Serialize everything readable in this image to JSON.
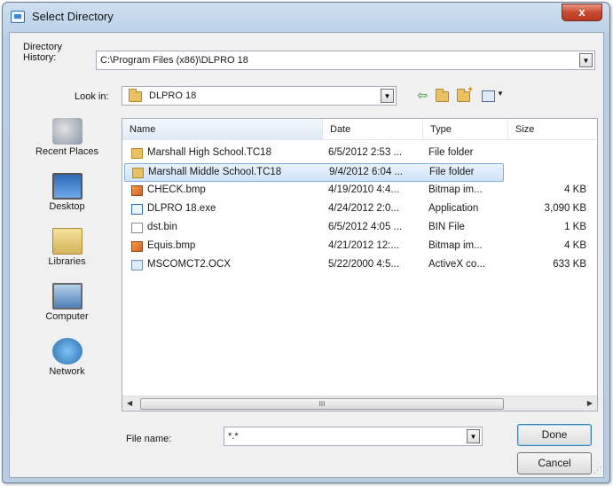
{
  "window": {
    "title": "Select Directory",
    "close_label": "x"
  },
  "directory_history": {
    "label_line1": "Directory",
    "label_line2": "History:",
    "value": "C:\\Program Files (x86)\\DLPRO 18"
  },
  "look_in": {
    "label": "Look in:",
    "value": "DLPRO 18"
  },
  "toolbar": {
    "back_icon": "back-arrow-icon",
    "up_icon": "up-folder-icon",
    "new_folder_icon": "new-folder-icon",
    "view_icon": "view-menu-icon"
  },
  "places": [
    {
      "label": "Recent Places",
      "icon": "recent-places-icon"
    },
    {
      "label": "Desktop",
      "icon": "desktop-icon"
    },
    {
      "label": "Libraries",
      "icon": "libraries-icon"
    },
    {
      "label": "Computer",
      "icon": "computer-icon"
    },
    {
      "label": "Network",
      "icon": "network-icon"
    }
  ],
  "columns": {
    "name": "Name",
    "date": "Date",
    "type": "Type",
    "size": "Size"
  },
  "files": [
    {
      "name": "Marshall High School.TC18",
      "date": "6/5/2012 2:53 ...",
      "type": "File folder",
      "size": "",
      "icon": "folder"
    },
    {
      "name": "Marshall Middle School.TC18",
      "date": "9/4/2012 6:04 ...",
      "type": "File folder",
      "size": "",
      "icon": "folder"
    },
    {
      "name": "CHECK.bmp",
      "date": "4/19/2010 4:4...",
      "type": "Bitmap im...",
      "size": "4 KB",
      "icon": "bmp"
    },
    {
      "name": "DLPRO 18.exe",
      "date": "4/24/2012 2:0...",
      "type": "Application",
      "size": "3,090 KB",
      "icon": "exe"
    },
    {
      "name": "dst.bin",
      "date": "6/5/2012 4:05 ...",
      "type": "BIN File",
      "size": "1 KB",
      "icon": "bin"
    },
    {
      "name": "Equis.bmp",
      "date": "4/21/2012 12:...",
      "type": "Bitmap im...",
      "size": "4 KB",
      "icon": "bmp"
    },
    {
      "name": "MSCOMCT2.OCX",
      "date": "5/22/2000 4:5...",
      "type": "ActiveX co...",
      "size": "633 KB",
      "icon": "ocx"
    }
  ],
  "selected_row": 1,
  "file_name": {
    "label": "File name:",
    "value": "*.*"
  },
  "buttons": {
    "done": "Done",
    "cancel": "Cancel"
  },
  "scrollbar": {
    "thumb_grip": "III"
  }
}
